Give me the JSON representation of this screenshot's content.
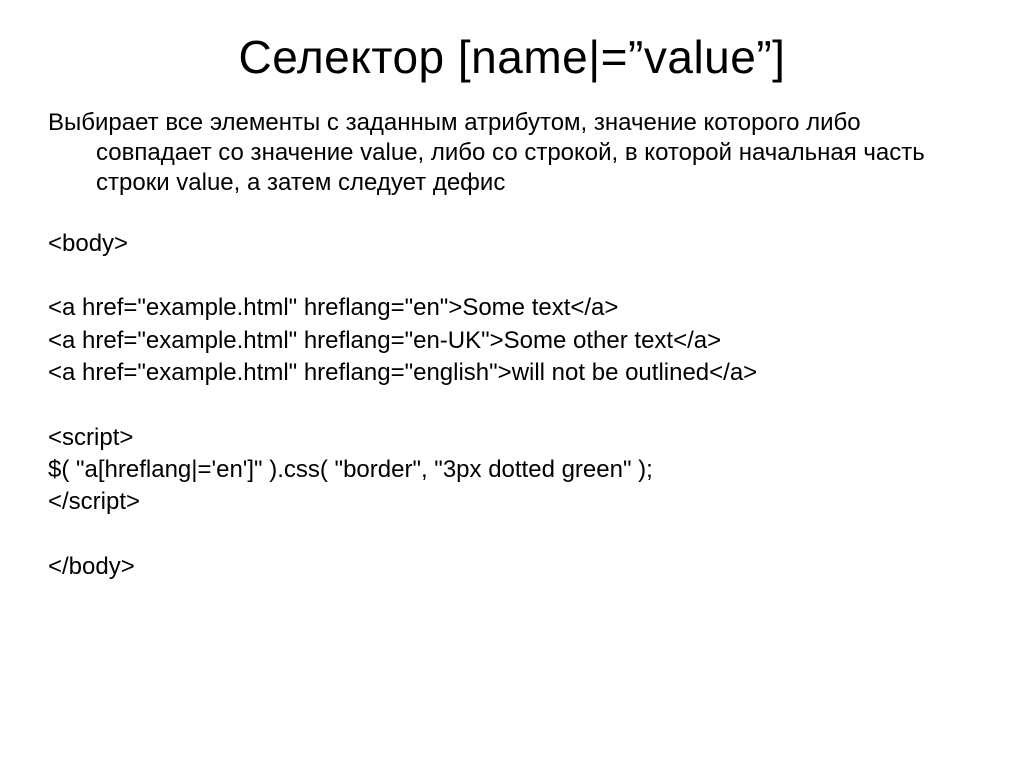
{
  "title": "Селектор  [name|=”value”]",
  "description": "Выбирает все элементы с заданным атрибутом, значение которого либо совпадает со значение value, либо со строкой, в которой начальная часть строки value, а затем следует дефис",
  "code": {
    "line1": "<body>",
    "line2": "<a href=\"example.html\" hreflang=\"en\">Some text</a>",
    "line3": "<a href=\"example.html\" hreflang=\"en-UK\">Some other text</a>",
    "line4": "<a href=\"example.html\" hreflang=\"english\">will not be outlined</a>",
    "line5": "<script>",
    "line6": "$( \"a[hreflang|='en']\" ).css( \"border\", \"3px dotted green\" );",
    "line7": "</script>",
    "line8": "</body>"
  }
}
